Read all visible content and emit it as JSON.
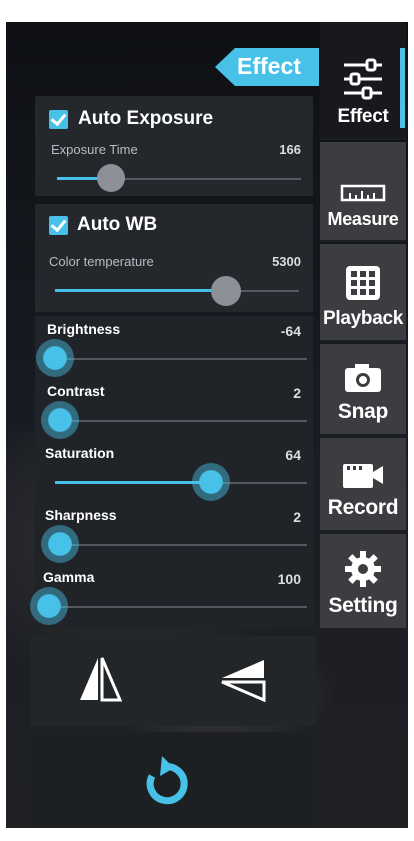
{
  "header": {
    "title": "Effect"
  },
  "tabs": [
    {
      "label": "Effect",
      "icon": "sliders-icon",
      "active": true
    },
    {
      "label": "Measure",
      "icon": "ruler-icon"
    },
    {
      "label": "Playback",
      "icon": "grid-icon"
    },
    {
      "label": "Snap",
      "icon": "camera-icon"
    },
    {
      "label": "Record",
      "icon": "video-camera-icon"
    },
    {
      "label": "Setting",
      "icon": "gear-icon"
    }
  ],
  "auto_exposure": {
    "label": "Auto Exposure",
    "checked": true,
    "slider_label": "Exposure Time",
    "value": "166",
    "fraction": 0.22
  },
  "auto_wb": {
    "label": "Auto WB",
    "checked": true,
    "slider_label": "Color temperature",
    "value": "5300",
    "fraction": 0.7
  },
  "sliders": [
    {
      "label": "Brightness",
      "value": "-64",
      "fraction": 0.0
    },
    {
      "label": "Contrast",
      "value": "2",
      "fraction": 0.02
    },
    {
      "label": "Saturation",
      "value": "64",
      "fraction": 0.62
    },
    {
      "label": "Sharpness",
      "value": "2",
      "fraction": 0.02
    },
    {
      "label": "Gamma",
      "value": "100",
      "fraction": 0.0
    }
  ],
  "actions": {
    "flip_horizontal_icon": "flip-horizontal-icon",
    "flip_vertical_icon": "flip-vertical-icon",
    "reset_icon": "reset-icon"
  },
  "colors": {
    "accent": "#47c1e8",
    "panel": "#24272b",
    "tab": "#3b3d41"
  }
}
